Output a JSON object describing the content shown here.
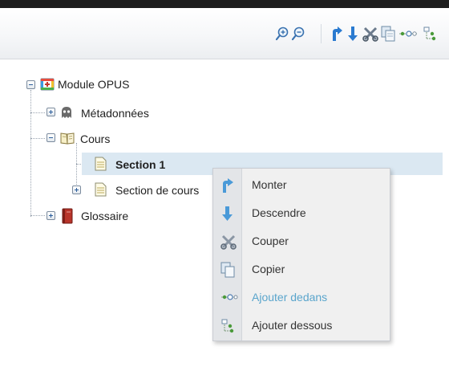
{
  "toolbar": {
    "buttons": [
      {
        "icon": "zoom-in-icon"
      },
      {
        "icon": "zoom-out-icon"
      },
      {
        "icon": "move-up-icon"
      },
      {
        "icon": "move-down-icon"
      },
      {
        "icon": "cut-icon"
      },
      {
        "icon": "copy-icon"
      },
      {
        "icon": "add-inside-icon"
      },
      {
        "icon": "add-below-icon"
      }
    ]
  },
  "tree": {
    "root": {
      "label": "Module OPUS",
      "icon": "module-icon"
    },
    "metadata": {
      "label": "Métadonnées",
      "icon": "ghost-icon"
    },
    "cours": {
      "label": "Cours",
      "icon": "open-book-icon"
    },
    "section1": {
      "label": "Section 1",
      "icon": "document-icon",
      "selected": true
    },
    "section_cours": {
      "label": "Section de cours",
      "icon": "document-icon"
    },
    "glossaire": {
      "label": "Glossaire",
      "icon": "red-book-icon"
    }
  },
  "context_menu": {
    "items": [
      {
        "label": "Monter",
        "icon": "move-up-icon",
        "enabled": true
      },
      {
        "label": "Descendre",
        "icon": "move-down-icon",
        "enabled": true
      },
      {
        "label": "Couper",
        "icon": "cut-icon",
        "enabled": true
      },
      {
        "label": "Copier",
        "icon": "copy-icon",
        "enabled": true
      },
      {
        "label": "Ajouter dedans",
        "icon": "add-inside-icon",
        "enabled": false
      },
      {
        "label": "Ajouter dessous",
        "icon": "add-below-icon",
        "enabled": true
      }
    ]
  },
  "colors": {
    "selection": "#dbe8f2",
    "accent_blue": "#2a78c8",
    "disabled_text": "#5aa5cc",
    "menu_bg": "#f0f0f0"
  }
}
